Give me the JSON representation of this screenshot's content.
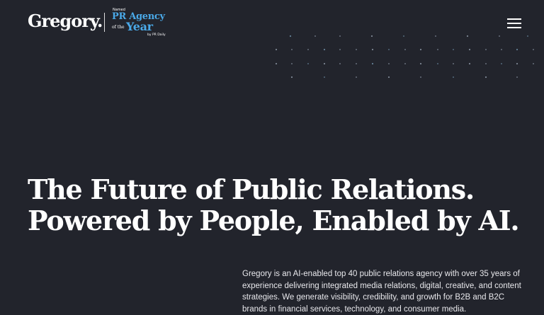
{
  "header": {
    "logo_text": "Gregory.",
    "award": {
      "named": "Named",
      "line1": "PR Agency",
      "of_the": "of the",
      "year": "Year",
      "by": "by PR Daily"
    },
    "menu_icon": "hamburger-menu-icon"
  },
  "hero": {
    "line1": "The Future of Public Relations.",
    "line2": "Powered by People, Enabled by AI."
  },
  "intro": {
    "text": "Gregory is an AI-enabled top 40 public relations agency with over 35 years of experience delivering integrated media relations, digital, creative, and content strategies. We generate visibility, credibility, and growth for B2B and B2C brands in financial services, technology, and consumer media."
  },
  "colors": {
    "background": "#22242c",
    "accent": "#4aa9e8",
    "text": "#ffffff"
  }
}
